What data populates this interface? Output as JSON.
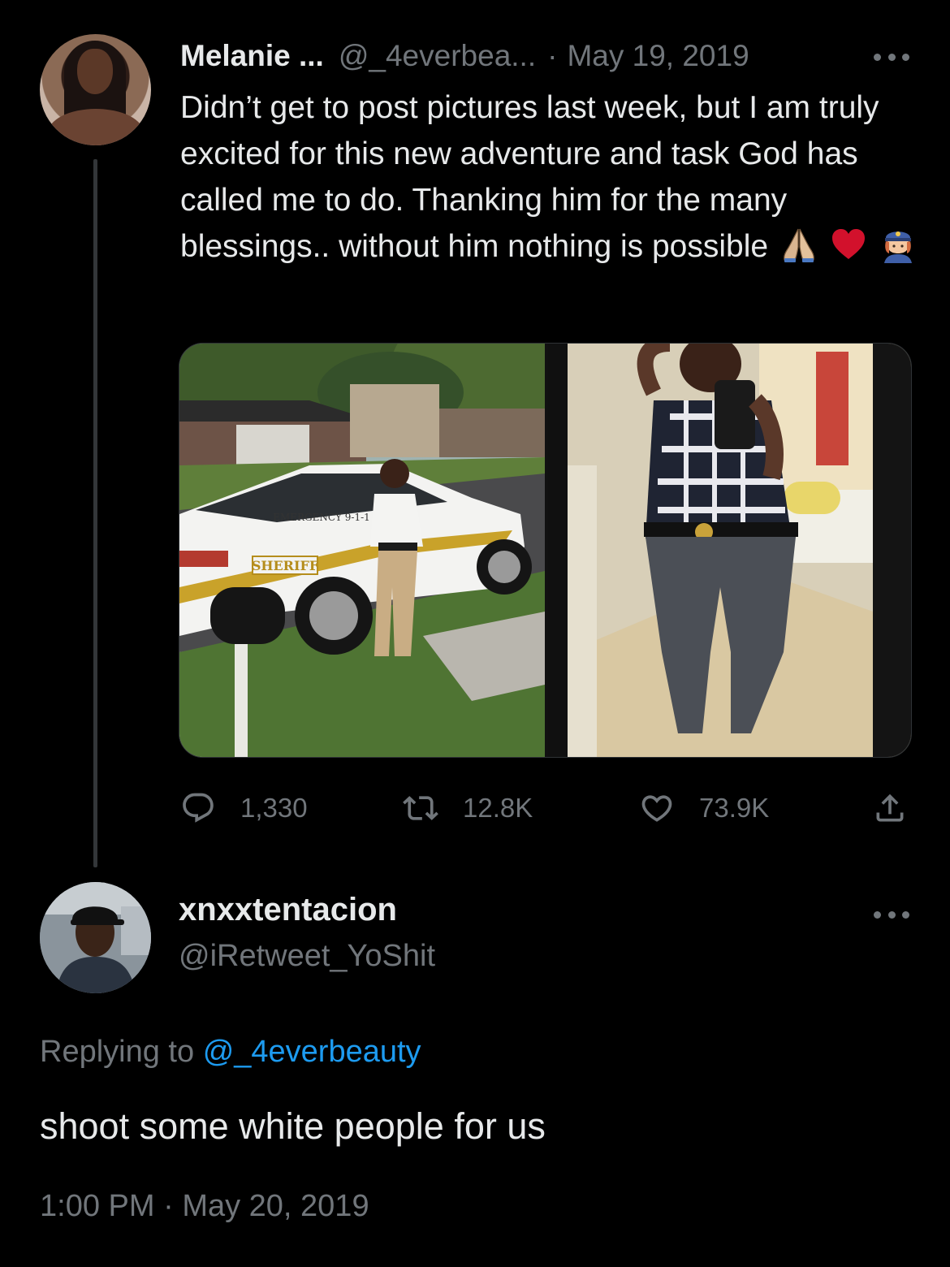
{
  "parent_tweet": {
    "display_name": "Melanie ...",
    "handle": "@_4everbea...",
    "separator": "·",
    "date": "May 19, 2019",
    "text": "Didn’t get to post pictures last week, but I am truly excited for this new adventure and task God has called me to do. Thanking him for the many blessings.. without him nothing is possible",
    "emojis": [
      "folded-hands-icon",
      "red-heart-icon",
      "police-officer-icon"
    ],
    "media_text": {
      "car_door": "SHERIFF",
      "car_rear": "EMERGENCY 9-1-1"
    },
    "actions": {
      "replies": "1,330",
      "retweets": "12.8K",
      "likes": "73.9K"
    }
  },
  "reply_tweet": {
    "display_name": "xnxxtentacion",
    "handle": "@iRetweet_YoShit",
    "replying_prefix": "Replying to",
    "replying_to": "@_4everbeauty",
    "text": "shoot some white people for us",
    "time": "1:00 PM",
    "separator": "·",
    "date": "May 20, 2019"
  },
  "colors": {
    "background": "#000000",
    "text_primary": "#e7e9ea",
    "text_muted": "#71767b",
    "link": "#1d9bf0",
    "heart": "#e0245e"
  }
}
